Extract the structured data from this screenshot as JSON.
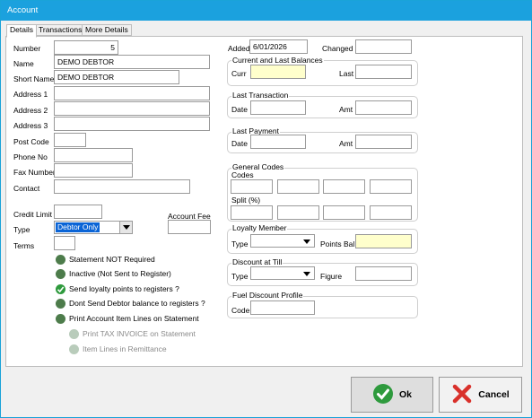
{
  "window": {
    "title": "Account"
  },
  "tabs": [
    {
      "label": "Details"
    },
    {
      "label": "Transactions"
    },
    {
      "label": "More Details"
    }
  ],
  "left": {
    "number": {
      "label": "Number",
      "value": "5"
    },
    "name": {
      "label": "Name",
      "value": "DEMO DEBTOR"
    },
    "short_name": {
      "label": "Short Name",
      "value": "DEMO DEBTOR"
    },
    "address1": {
      "label": "Address 1",
      "value": ""
    },
    "address2": {
      "label": "Address 2",
      "value": ""
    },
    "address3": {
      "label": "Address 3",
      "value": ""
    },
    "post_code": {
      "label": "Post Code",
      "value": ""
    },
    "phone": {
      "label": "Phone No",
      "value": ""
    },
    "fax": {
      "label": "Fax Number",
      "value": ""
    },
    "contact": {
      "label": "Contact",
      "value": ""
    },
    "credit_limit": {
      "label": "Credit Limit",
      "value": ""
    },
    "account_fee": {
      "label": "Account Fee",
      "value": ""
    },
    "type": {
      "label": "Type",
      "value": "Debtor Only"
    },
    "terms": {
      "label": "Terms",
      "value": ""
    }
  },
  "options": [
    {
      "label": "Statement NOT Required",
      "state": "off",
      "enabled": true
    },
    {
      "label": "Inactive (Not Sent to Register)",
      "state": "off",
      "enabled": true
    },
    {
      "label": "Send loyalty points to registers ?",
      "state": "on",
      "enabled": true
    },
    {
      "label": "Dont Send Debtor balance to registers ?",
      "state": "off",
      "enabled": true
    },
    {
      "label": "Print Account Item Lines on Statement",
      "state": "off",
      "enabled": true
    },
    {
      "label": "Print TAX INVOICE on Statement",
      "state": "off",
      "enabled": false
    },
    {
      "label": "Item Lines in Remittance",
      "state": "off",
      "enabled": false
    }
  ],
  "right": {
    "added": {
      "label": "Added",
      "value": "6/01/2026"
    },
    "changed": {
      "label": "Changed",
      "value": ""
    },
    "balances": {
      "title": "Current and Last Balances",
      "curr_label": "Curr",
      "last_label": "Last"
    },
    "last_transaction": {
      "title": "Last Transaction",
      "date_label": "Date",
      "amt_label": "Amt"
    },
    "last_payment": {
      "title": "Last Payment",
      "date_label": "Date",
      "amt_label": "Amt"
    },
    "general_codes": {
      "title": "General Codes",
      "codes_label": "Codes",
      "split_label": "Split (%)"
    },
    "loyalty": {
      "title": "Loyalty Member",
      "type_label": "Type",
      "points_label": "Points Bal"
    },
    "discount": {
      "title": "Discount at Till",
      "type_label": "Type",
      "figure_label": "Figure"
    },
    "fuel": {
      "title": "Fuel Discount Profile",
      "code_label": "Code"
    }
  },
  "buttons": {
    "ok": "Ok",
    "cancel": "Cancel"
  },
  "colors": {
    "title_bar": "#1ba1de",
    "highlight": "#0a64d6",
    "ok_green": "#2e9a3d",
    "cancel_red": "#d9312b",
    "yellow_field": "#ffffcc"
  }
}
